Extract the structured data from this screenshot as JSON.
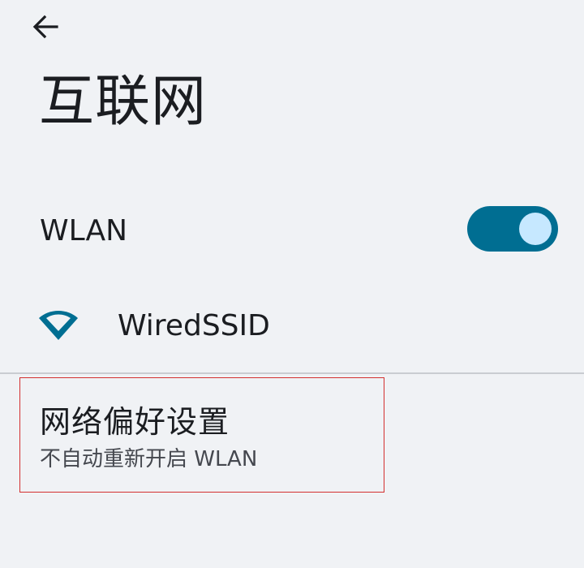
{
  "header": {
    "back_icon": "arrow-back-icon",
    "title": "互联网"
  },
  "wlan": {
    "label": "WLAN",
    "toggle_state": "on",
    "toggle_color": "#006e92",
    "thumb_color": "#c6e8ff"
  },
  "network": {
    "icon": "wifi-icon",
    "ssid": "WiredSSID",
    "icon_color": "#006e92"
  },
  "preferences": {
    "title": "网络偏好设置",
    "subtitle": "不自动重新开启 WLAN"
  },
  "colors": {
    "background": "#f0f2f5",
    "text": "#1b1d21",
    "secondary_text": "#45484f",
    "divider": "#c9ccd1",
    "highlight": "#d32f2f"
  }
}
